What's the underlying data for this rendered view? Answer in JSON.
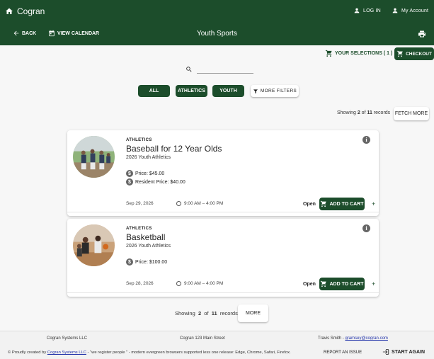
{
  "header": {
    "brand": "Cogran",
    "login_label": "LOG IN",
    "account_label": "My Account",
    "back_label": "BACK",
    "calendar_label": "VIEW CALENDAR",
    "page_title": "Youth Sports"
  },
  "toolbar": {
    "selections_label": "YOUR SELECTIONS ( 1 )",
    "checkout_label": "CHECKOUT"
  },
  "search": {
    "placeholder": "",
    "value": ""
  },
  "filters": {
    "items": [
      "ALL",
      "ATHLETICS",
      "YOUTH"
    ],
    "more_label": "MORE FILTERS"
  },
  "results_top": {
    "prefix": "Showing",
    "shown": "2",
    "of": "of",
    "total": "11",
    "suffix": "records",
    "fetch_label": "FETCH MORE"
  },
  "programs": [
    {
      "category": "ATHLETICS",
      "name": "Baseball for 12 Year Olds",
      "season": "2026 Youth Athletics",
      "price": "Price: $45.00",
      "resident_price": "Resident Price: $40.00",
      "date": "Sep 29, 2026",
      "time": "9:00 AM – 4:00 PM",
      "status": "Open",
      "add_label": "ADD TO CART",
      "plus": "+"
    },
    {
      "category": "ATHLETICS",
      "name": "Basketball",
      "season": "2026 Youth Athletics",
      "price": "Price: $100.00",
      "date": "Sep 28, 2026",
      "time": "9:00 AM – 4:00 PM",
      "status": "Open",
      "add_label": "ADD TO CART",
      "plus": "+"
    }
  ],
  "results_bottom": {
    "prefix": "Showing",
    "shown": "2",
    "of": "of",
    "total": "11",
    "suffix": "records",
    "more_label": "MORE"
  },
  "footer": {
    "company": "Cogran Systems LLC",
    "address": "Cogran 123 Main Street",
    "contact_name": "Travis Smith -",
    "contact_email": "gramsey@cogran.com",
    "credit_prefix": "© Proudly created by",
    "credit_link": "Cogran Systems LLC",
    "credit_suffix": "- \"we register people \" - modern evergreen browsers supported less one release: Edge, Chrome, Safari, Firefox.",
    "report_label": "REPORT AN ISSUE",
    "start_label": "START AGAIN"
  },
  "colors": {
    "primary": "#1c4d2b",
    "background": "#f7f7f7",
    "card": "#ffffff"
  }
}
